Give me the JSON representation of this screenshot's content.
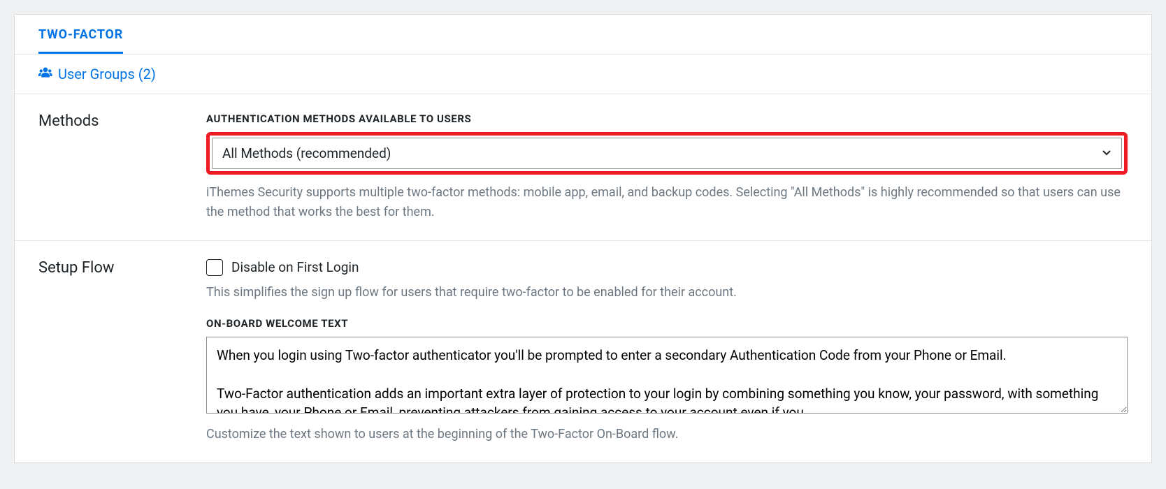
{
  "tab": {
    "label": "TWO-FACTOR"
  },
  "userGroups": {
    "label": "User Groups (2)"
  },
  "methods": {
    "sectionTitle": "Methods",
    "fieldLabel": "AUTHENTICATION METHODS AVAILABLE TO USERS",
    "selectValue": "All Methods (recommended)",
    "helpText": "iThemes Security supports multiple two-factor methods: mobile app, email, and backup codes. Selecting \"All Methods\" is highly recommended so that users can use the method that works the best for them."
  },
  "setupFlow": {
    "sectionTitle": "Setup Flow",
    "checkboxLabel": "Disable on First Login",
    "checkboxHelp": "This simplifies the sign up flow for users that require two-factor to be enabled for their account.",
    "onboardLabel": "ON-BOARD WELCOME TEXT",
    "onboardValue": "When you login using Two-factor authenticator you'll be prompted to enter a secondary Authentication Code from your Phone or Email.\n\nTwo-Factor authentication adds an important extra layer of protection to your login by combining something you know, your password, with something you have, your Phone or Email, preventing attackers from gaining access to your account even if you",
    "onboardHelp": "Customize the text shown to users at the beginning of the Two-Factor On-Board flow."
  }
}
